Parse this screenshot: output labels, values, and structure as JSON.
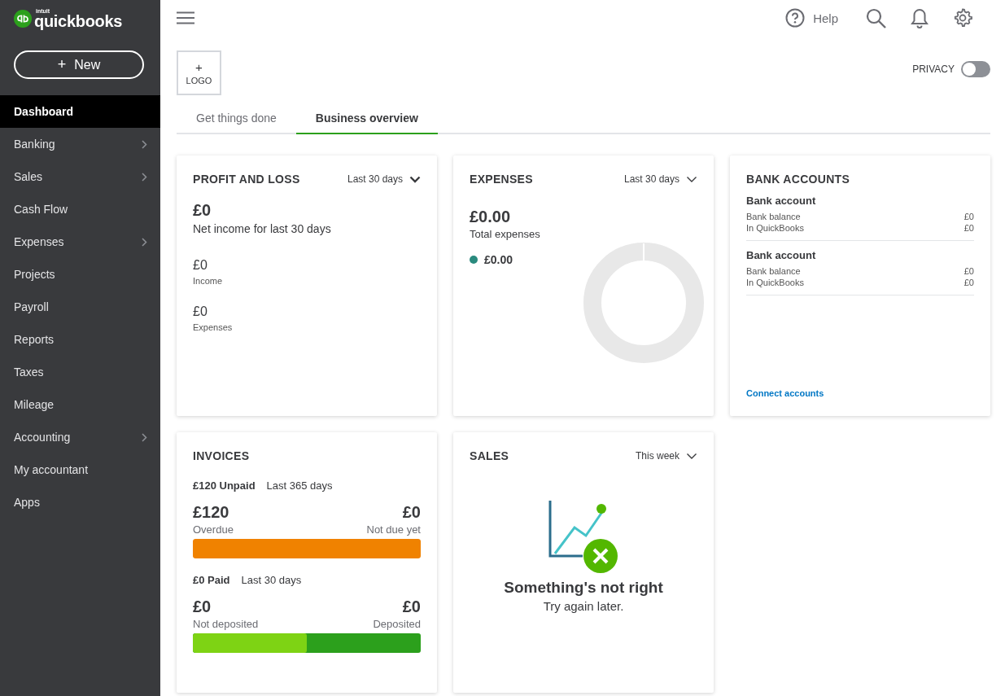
{
  "brand": {
    "small": "intuit",
    "name": "quickbooks"
  },
  "new_button": {
    "icon": "+",
    "label": "New"
  },
  "sidebar": {
    "items": [
      {
        "label": "Dashboard",
        "selected": true,
        "has_submenu": false
      },
      {
        "label": "Banking",
        "selected": false,
        "has_submenu": true
      },
      {
        "label": "Sales",
        "selected": false,
        "has_submenu": true
      },
      {
        "label": "Cash Flow",
        "selected": false,
        "has_submenu": false
      },
      {
        "label": "Expenses",
        "selected": false,
        "has_submenu": true
      },
      {
        "label": "Projects",
        "selected": false,
        "has_submenu": false
      },
      {
        "label": "Payroll",
        "selected": false,
        "has_submenu": false
      },
      {
        "label": "Reports",
        "selected": false,
        "has_submenu": false
      },
      {
        "label": "Taxes",
        "selected": false,
        "has_submenu": false
      },
      {
        "label": "Mileage",
        "selected": false,
        "has_submenu": false
      },
      {
        "label": "Accounting",
        "selected": false,
        "has_submenu": true
      },
      {
        "label": "My accountant",
        "selected": false,
        "has_submenu": false
      },
      {
        "label": "Apps",
        "selected": false,
        "has_submenu": false
      }
    ]
  },
  "topbar": {
    "help": "Help"
  },
  "logo_box": {
    "icon": "+",
    "label": "LOGO"
  },
  "privacy": {
    "label": "PRIVACY",
    "on": false
  },
  "tabs": [
    {
      "label": "Get things done",
      "selected": false
    },
    {
      "label": "Business overview",
      "selected": true
    }
  ],
  "profit_loss": {
    "title": "PROFIT AND LOSS",
    "period": "Last 30 days",
    "net": "£0",
    "net_label": "Net income for last 30 days",
    "rows": [
      {
        "value": "£0",
        "label": "Income"
      },
      {
        "value": "£0",
        "label": "Expenses"
      }
    ]
  },
  "expenses": {
    "title": "EXPENSES",
    "period": "Last 30 days",
    "total": "£0.00",
    "total_label": "Total expenses",
    "legend": [
      {
        "value": "£0.00",
        "color": "#2a8a7e"
      }
    ]
  },
  "bank_accounts": {
    "title": "BANK ACCOUNTS",
    "accounts": [
      {
        "name": "Bank account",
        "rows": [
          {
            "label": "Bank balance",
            "value": "£0"
          },
          {
            "label": "In QuickBooks",
            "value": "£0"
          }
        ]
      },
      {
        "name": "Bank account",
        "rows": [
          {
            "label": "Bank balance",
            "value": "£0"
          },
          {
            "label": "In QuickBooks",
            "value": "£0"
          }
        ]
      }
    ],
    "link": "Connect accounts"
  },
  "invoices": {
    "title": "INVOICES",
    "groups": [
      {
        "kind": "unpaid",
        "summary": "£120 Unpaid",
        "period": "Last 365 days",
        "left_value": "£120",
        "left_label": "Overdue",
        "right_value": "£0",
        "right_label": "Not due yet",
        "level": 1
      },
      {
        "kind": "paid",
        "summary": "£0 Paid",
        "period": "Last 30 days",
        "left_value": "£0",
        "left_label": "Not deposited",
        "right_value": "£0",
        "right_label": "Deposited",
        "level": 0.5
      }
    ]
  },
  "sales": {
    "title": "SALES",
    "period": "This week",
    "error_title": "Something's not right",
    "error_text": "Try again later."
  }
}
